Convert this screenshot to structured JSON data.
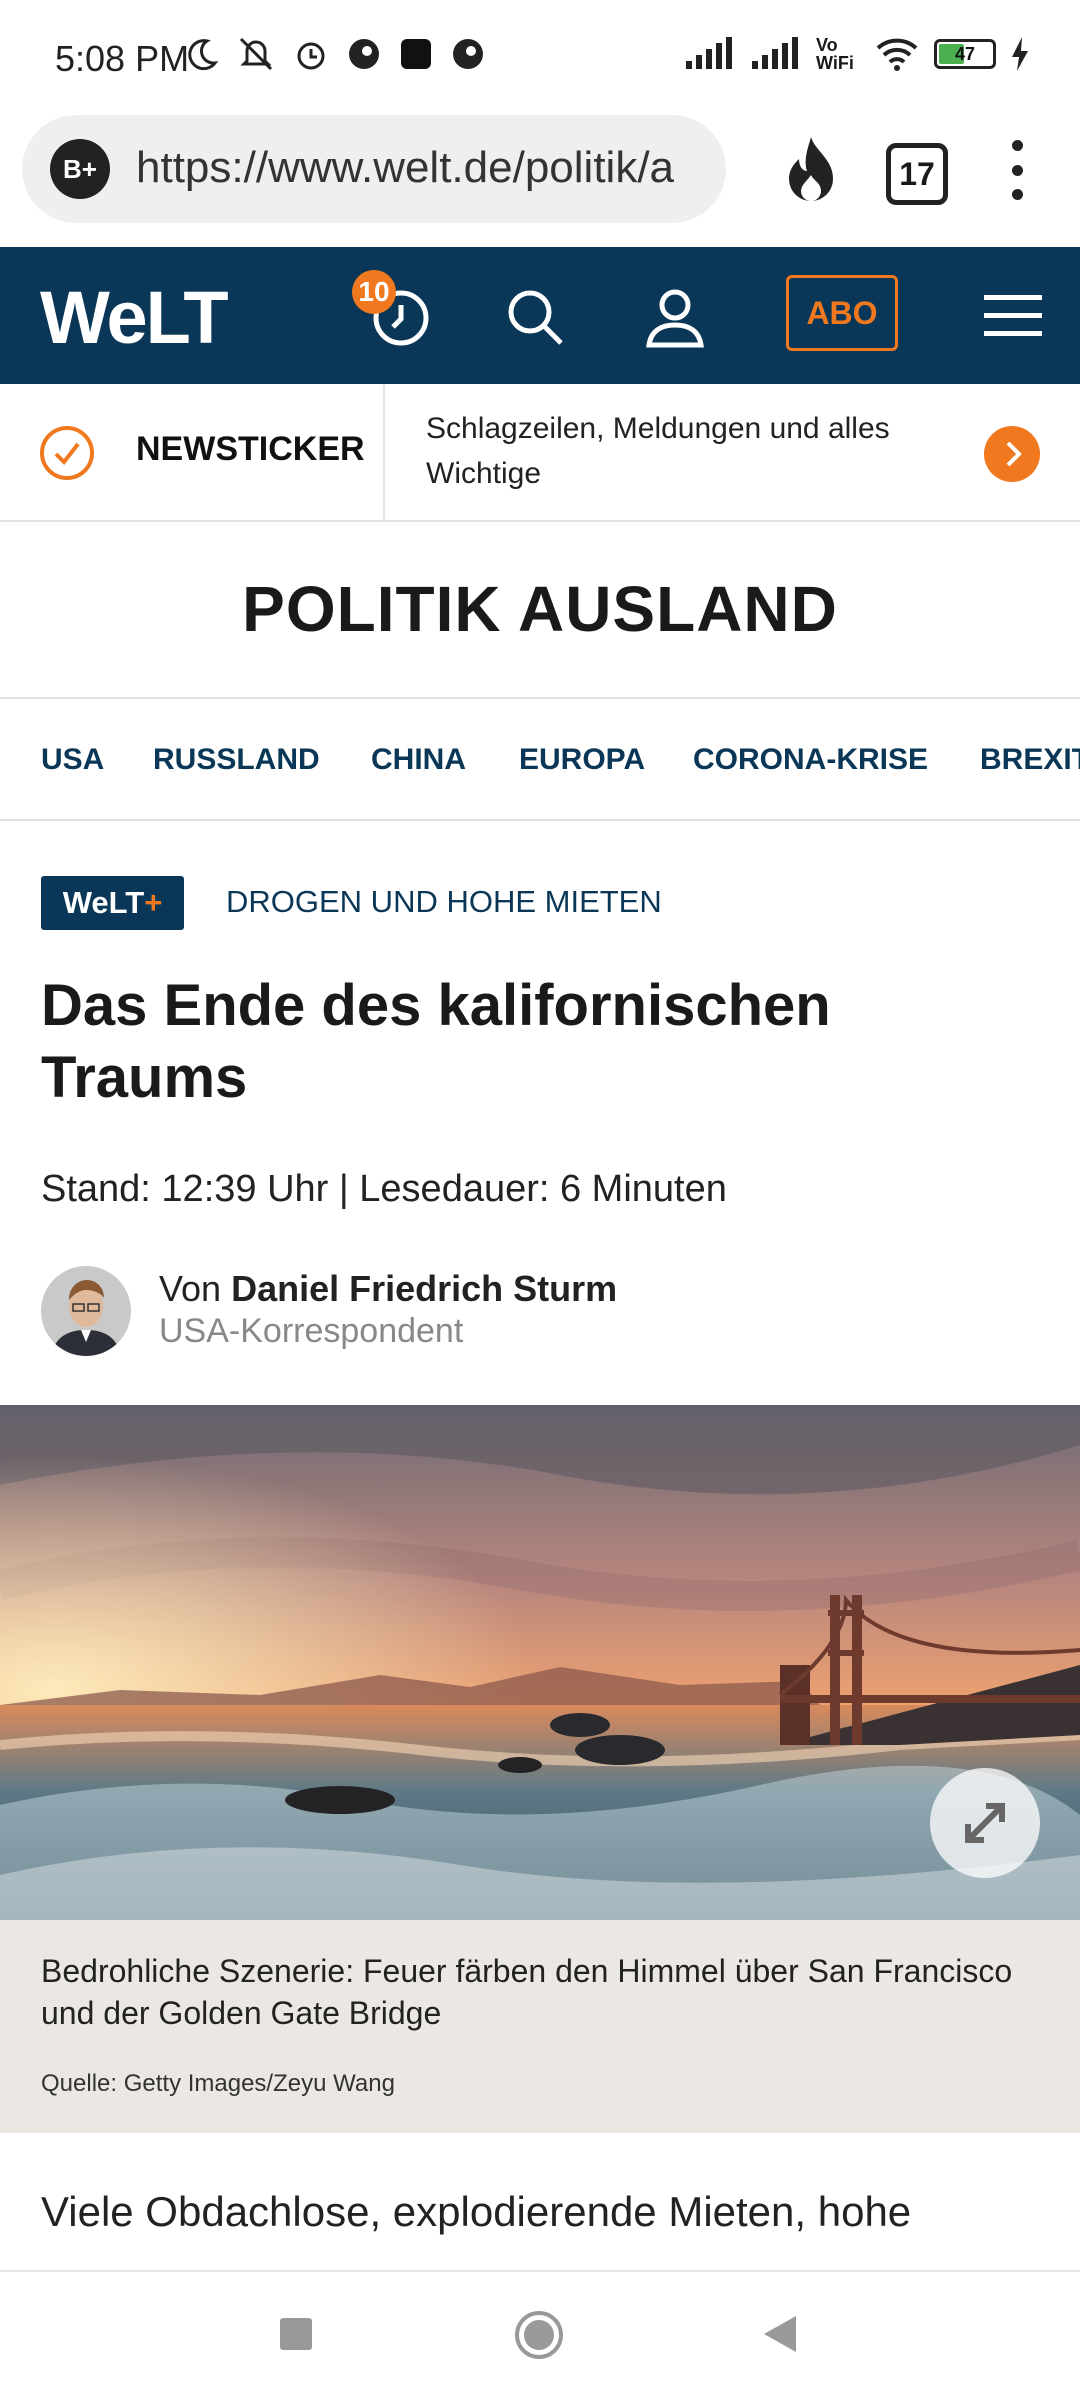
{
  "status_bar": {
    "time": "5:08 PM",
    "battery": "47",
    "network": "Vo WiFi"
  },
  "browser": {
    "site_badge": "B+",
    "url": "https://www.welt.de/politik/a",
    "tab_count": "17"
  },
  "header": {
    "logo": "WeLT",
    "notification_count": "10",
    "abo_label": "ABO"
  },
  "newsticker": {
    "label": "NEWSTICKER",
    "text": "Schlagzeilen, Meldungen und alles Wichtige"
  },
  "section": {
    "title": "POLITIK AUSLAND"
  },
  "nav": {
    "items": [
      "USA",
      "RUSSLAND",
      "CHINA",
      "EUROPA",
      "CORONA-KRISE",
      "BREXIT"
    ]
  },
  "article": {
    "badge": "WeLT",
    "badge_plus": "+",
    "kicker": "DROGEN UND HOHE MIETEN",
    "headline": "Das Ende des kalifornischen Traums",
    "meta": "Stand: 12:39 Uhr | Lesedauer: 6 Minuten",
    "author_prefix": "Von",
    "author_name": "Daniel Friedrich Sturm",
    "author_role": "USA-Korrespondent",
    "image_caption": "Bedrohliche Szenerie: Feuer färben den Himmel über San Francisco und der Golden Gate Bridge",
    "image_source": "Quelle: Getty Images/Zeyu Wang",
    "lead": "Viele Obdachlose, explodierende Mieten, hohe"
  },
  "colors": {
    "brand_navy": "#0a3757",
    "accent_orange": "#f0781e"
  }
}
